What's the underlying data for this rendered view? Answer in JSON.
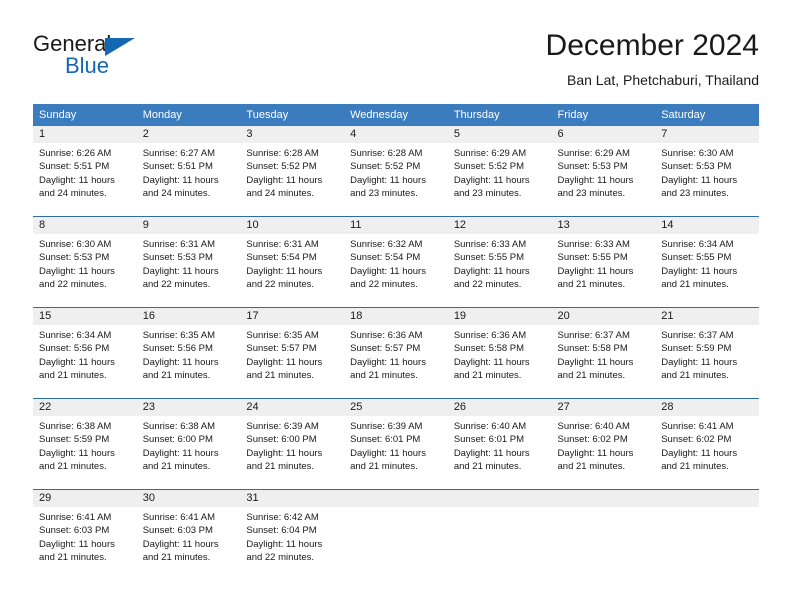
{
  "brand": {
    "name_part1": "General",
    "name_part2": "Blue",
    "accent_color": "#1667b2",
    "flag_icon": "triangle-flag-icon"
  },
  "header": {
    "month_title": "December 2024",
    "location": "Ban Lat, Phetchaburi, Thailand"
  },
  "calendar": {
    "header_bg": "#3a7cbe",
    "daynum_bg": "#efefef",
    "weekday_headers": [
      "Sunday",
      "Monday",
      "Tuesday",
      "Wednesday",
      "Thursday",
      "Friday",
      "Saturday"
    ],
    "weeks": [
      [
        {
          "day": "1",
          "sunrise": "Sunrise: 6:26 AM",
          "sunset": "Sunset: 5:51 PM",
          "daylight_line1": "Daylight: 11 hours",
          "daylight_line2": "and 24 minutes."
        },
        {
          "day": "2",
          "sunrise": "Sunrise: 6:27 AM",
          "sunset": "Sunset: 5:51 PM",
          "daylight_line1": "Daylight: 11 hours",
          "daylight_line2": "and 24 minutes."
        },
        {
          "day": "3",
          "sunrise": "Sunrise: 6:28 AM",
          "sunset": "Sunset: 5:52 PM",
          "daylight_line1": "Daylight: 11 hours",
          "daylight_line2": "and 24 minutes."
        },
        {
          "day": "4",
          "sunrise": "Sunrise: 6:28 AM",
          "sunset": "Sunset: 5:52 PM",
          "daylight_line1": "Daylight: 11 hours",
          "daylight_line2": "and 23 minutes."
        },
        {
          "day": "5",
          "sunrise": "Sunrise: 6:29 AM",
          "sunset": "Sunset: 5:52 PM",
          "daylight_line1": "Daylight: 11 hours",
          "daylight_line2": "and 23 minutes."
        },
        {
          "day": "6",
          "sunrise": "Sunrise: 6:29 AM",
          "sunset": "Sunset: 5:53 PM",
          "daylight_line1": "Daylight: 11 hours",
          "daylight_line2": "and 23 minutes."
        },
        {
          "day": "7",
          "sunrise": "Sunrise: 6:30 AM",
          "sunset": "Sunset: 5:53 PM",
          "daylight_line1": "Daylight: 11 hours",
          "daylight_line2": "and 23 minutes."
        }
      ],
      [
        {
          "day": "8",
          "sunrise": "Sunrise: 6:30 AM",
          "sunset": "Sunset: 5:53 PM",
          "daylight_line1": "Daylight: 11 hours",
          "daylight_line2": "and 22 minutes."
        },
        {
          "day": "9",
          "sunrise": "Sunrise: 6:31 AM",
          "sunset": "Sunset: 5:53 PM",
          "daylight_line1": "Daylight: 11 hours",
          "daylight_line2": "and 22 minutes."
        },
        {
          "day": "10",
          "sunrise": "Sunrise: 6:31 AM",
          "sunset": "Sunset: 5:54 PM",
          "daylight_line1": "Daylight: 11 hours",
          "daylight_line2": "and 22 minutes."
        },
        {
          "day": "11",
          "sunrise": "Sunrise: 6:32 AM",
          "sunset": "Sunset: 5:54 PM",
          "daylight_line1": "Daylight: 11 hours",
          "daylight_line2": "and 22 minutes."
        },
        {
          "day": "12",
          "sunrise": "Sunrise: 6:33 AM",
          "sunset": "Sunset: 5:55 PM",
          "daylight_line1": "Daylight: 11 hours",
          "daylight_line2": "and 22 minutes."
        },
        {
          "day": "13",
          "sunrise": "Sunrise: 6:33 AM",
          "sunset": "Sunset: 5:55 PM",
          "daylight_line1": "Daylight: 11 hours",
          "daylight_line2": "and 21 minutes."
        },
        {
          "day": "14",
          "sunrise": "Sunrise: 6:34 AM",
          "sunset": "Sunset: 5:55 PM",
          "daylight_line1": "Daylight: 11 hours",
          "daylight_line2": "and 21 minutes."
        }
      ],
      [
        {
          "day": "15",
          "sunrise": "Sunrise: 6:34 AM",
          "sunset": "Sunset: 5:56 PM",
          "daylight_line1": "Daylight: 11 hours",
          "daylight_line2": "and 21 minutes."
        },
        {
          "day": "16",
          "sunrise": "Sunrise: 6:35 AM",
          "sunset": "Sunset: 5:56 PM",
          "daylight_line1": "Daylight: 11 hours",
          "daylight_line2": "and 21 minutes."
        },
        {
          "day": "17",
          "sunrise": "Sunrise: 6:35 AM",
          "sunset": "Sunset: 5:57 PM",
          "daylight_line1": "Daylight: 11 hours",
          "daylight_line2": "and 21 minutes."
        },
        {
          "day": "18",
          "sunrise": "Sunrise: 6:36 AM",
          "sunset": "Sunset: 5:57 PM",
          "daylight_line1": "Daylight: 11 hours",
          "daylight_line2": "and 21 minutes."
        },
        {
          "day": "19",
          "sunrise": "Sunrise: 6:36 AM",
          "sunset": "Sunset: 5:58 PM",
          "daylight_line1": "Daylight: 11 hours",
          "daylight_line2": "and 21 minutes."
        },
        {
          "day": "20",
          "sunrise": "Sunrise: 6:37 AM",
          "sunset": "Sunset: 5:58 PM",
          "daylight_line1": "Daylight: 11 hours",
          "daylight_line2": "and 21 minutes."
        },
        {
          "day": "21",
          "sunrise": "Sunrise: 6:37 AM",
          "sunset": "Sunset: 5:59 PM",
          "daylight_line1": "Daylight: 11 hours",
          "daylight_line2": "and 21 minutes."
        }
      ],
      [
        {
          "day": "22",
          "sunrise": "Sunrise: 6:38 AM",
          "sunset": "Sunset: 5:59 PM",
          "daylight_line1": "Daylight: 11 hours",
          "daylight_line2": "and 21 minutes."
        },
        {
          "day": "23",
          "sunrise": "Sunrise: 6:38 AM",
          "sunset": "Sunset: 6:00 PM",
          "daylight_line1": "Daylight: 11 hours",
          "daylight_line2": "and 21 minutes."
        },
        {
          "day": "24",
          "sunrise": "Sunrise: 6:39 AM",
          "sunset": "Sunset: 6:00 PM",
          "daylight_line1": "Daylight: 11 hours",
          "daylight_line2": "and 21 minutes."
        },
        {
          "day": "25",
          "sunrise": "Sunrise: 6:39 AM",
          "sunset": "Sunset: 6:01 PM",
          "daylight_line1": "Daylight: 11 hours",
          "daylight_line2": "and 21 minutes."
        },
        {
          "day": "26",
          "sunrise": "Sunrise: 6:40 AM",
          "sunset": "Sunset: 6:01 PM",
          "daylight_line1": "Daylight: 11 hours",
          "daylight_line2": "and 21 minutes."
        },
        {
          "day": "27",
          "sunrise": "Sunrise: 6:40 AM",
          "sunset": "Sunset: 6:02 PM",
          "daylight_line1": "Daylight: 11 hours",
          "daylight_line2": "and 21 minutes."
        },
        {
          "day": "28",
          "sunrise": "Sunrise: 6:41 AM",
          "sunset": "Sunset: 6:02 PM",
          "daylight_line1": "Daylight: 11 hours",
          "daylight_line2": "and 21 minutes."
        }
      ],
      [
        {
          "day": "29",
          "sunrise": "Sunrise: 6:41 AM",
          "sunset": "Sunset: 6:03 PM",
          "daylight_line1": "Daylight: 11 hours",
          "daylight_line2": "and 21 minutes."
        },
        {
          "day": "30",
          "sunrise": "Sunrise: 6:41 AM",
          "sunset": "Sunset: 6:03 PM",
          "daylight_line1": "Daylight: 11 hours",
          "daylight_line2": "and 21 minutes."
        },
        {
          "day": "31",
          "sunrise": "Sunrise: 6:42 AM",
          "sunset": "Sunset: 6:04 PM",
          "daylight_line1": "Daylight: 11 hours",
          "daylight_line2": "and 22 minutes."
        },
        {
          "day": "",
          "sunrise": "",
          "sunset": "",
          "daylight_line1": "",
          "daylight_line2": ""
        },
        {
          "day": "",
          "sunrise": "",
          "sunset": "",
          "daylight_line1": "",
          "daylight_line2": ""
        },
        {
          "day": "",
          "sunrise": "",
          "sunset": "",
          "daylight_line1": "",
          "daylight_line2": ""
        },
        {
          "day": "",
          "sunrise": "",
          "sunset": "",
          "daylight_line1": "",
          "daylight_line2": ""
        }
      ]
    ]
  }
}
